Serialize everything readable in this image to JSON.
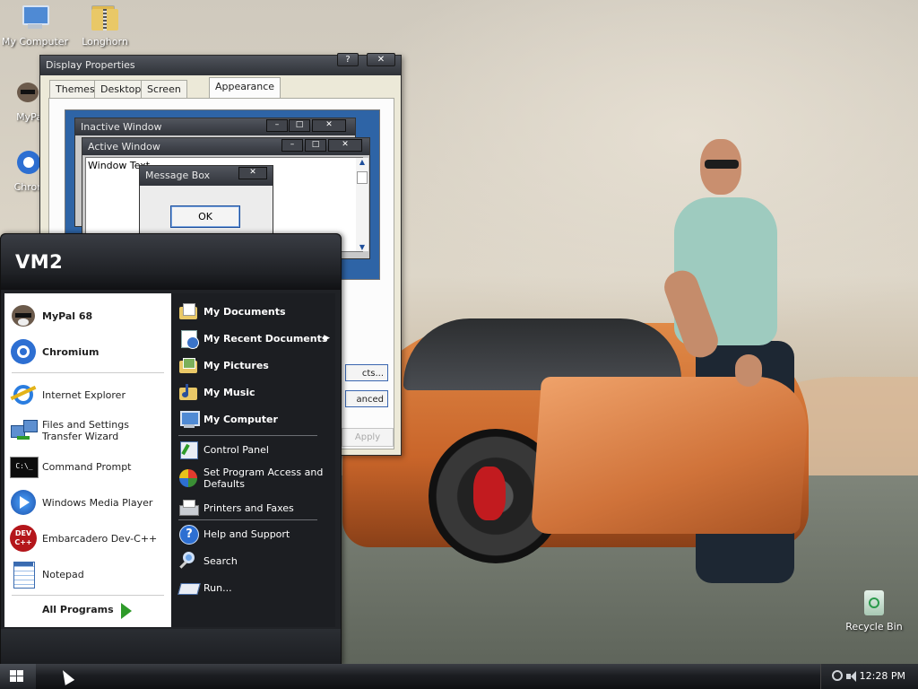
{
  "desktop": {
    "icons": [
      {
        "label": "My Computer"
      },
      {
        "label": "Longhorn"
      },
      {
        "label": "MyPal"
      },
      {
        "label": "Chrom"
      },
      {
        "label": "Recycle Bin"
      }
    ]
  },
  "display_properties": {
    "title": "Display Properties",
    "help_label": "?",
    "close_label": "✕",
    "tabs": [
      "Themes",
      "Desktop",
      "Screen Saver",
      "Appearance"
    ],
    "active_tab": "Appearance",
    "preview": {
      "inactive_title": "Inactive Window",
      "active_title": "Active Window",
      "window_text": "Window Text",
      "message_title": "Message Box",
      "ok_label": "OK"
    },
    "effects_partial": "cts...",
    "advanced_partial": "anced",
    "apply_label": "Apply"
  },
  "start_menu": {
    "user_name": "VM2",
    "pinned": [
      {
        "label": "MyPal 68",
        "icon": "raccoon-icon"
      },
      {
        "label": "Chromium",
        "icon": "chromium-icon"
      }
    ],
    "recent": [
      {
        "label": "Internet Explorer",
        "icon": "internet-explorer-icon"
      },
      {
        "label": "Files and Settings Transfer Wizard",
        "icon": "transfer-wizard-icon"
      },
      {
        "label": "Command Prompt",
        "icon": "command-prompt-icon"
      },
      {
        "label": "Windows Media Player",
        "icon": "media-player-icon"
      },
      {
        "label": "Embarcadero Dev-C++",
        "icon": "devcpp-icon"
      },
      {
        "label": "Notepad",
        "icon": "notepad-icon"
      }
    ],
    "all_programs": "All Programs",
    "right": [
      {
        "label": "My Documents",
        "icon": "documents-folder-icon"
      },
      {
        "label": "My Recent Documents",
        "icon": "recent-documents-icon"
      },
      {
        "label": "My Pictures",
        "icon": "pictures-folder-icon"
      },
      {
        "label": "My Music",
        "icon": "music-folder-icon"
      },
      {
        "label": "My Computer",
        "icon": "computer-icon"
      },
      {
        "label": "Control Panel",
        "icon": "control-panel-icon"
      },
      {
        "label": "Set Program Access and Defaults",
        "icon": "program-access-icon"
      },
      {
        "label": "Printers and Faxes",
        "icon": "printer-icon"
      },
      {
        "label": "Help and Support",
        "icon": "help-icon"
      },
      {
        "label": "Search",
        "icon": "search-icon"
      },
      {
        "label": "Run...",
        "icon": "run-icon"
      }
    ],
    "dev_icon_text": "DEV C++",
    "cmd_icon_text": "C:\\_"
  },
  "taskbar": {
    "clock": "12:28 PM"
  }
}
